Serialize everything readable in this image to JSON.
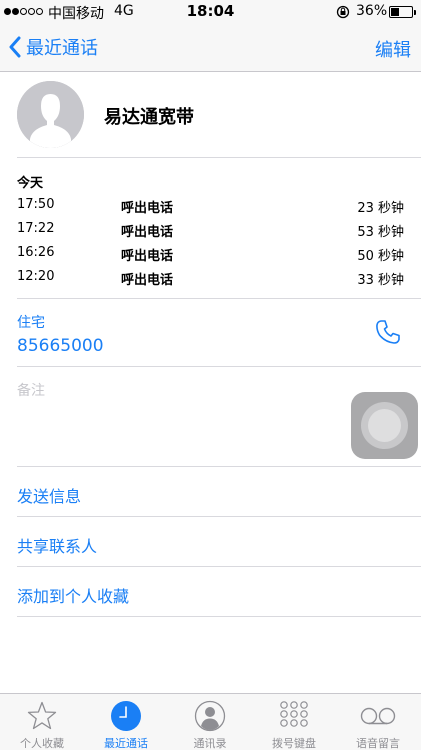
{
  "status_bar": {
    "carrier": "中国移动",
    "network": "4G",
    "time": "18:04",
    "battery": "36%",
    "battery_level": 0.36
  },
  "nav": {
    "back_label": "最近通话",
    "edit_label": "编辑"
  },
  "contact": {
    "name": "易达通宽带"
  },
  "calls": {
    "title": "今天",
    "items": [
      {
        "time": "17:50",
        "type": "呼出电话",
        "duration": "23 秒钟"
      },
      {
        "time": "17:22",
        "type": "呼出电话",
        "duration": "53 秒钟"
      },
      {
        "time": "16:26",
        "type": "呼出电话",
        "duration": "50 秒钟"
      },
      {
        "time": "12:20",
        "type": "呼出电话",
        "duration": "33 秒钟"
      }
    ]
  },
  "phone": {
    "label": "住宅",
    "number": "85665000"
  },
  "notes": {
    "label": "备注"
  },
  "actions": {
    "send_message": "发送信息",
    "share_contact": "共享联系人",
    "add_favorite": "添加到个人收藏"
  },
  "tabs": [
    {
      "label": "个人收藏",
      "icon": "star-icon"
    },
    {
      "label": "最近通话",
      "icon": "clock-icon"
    },
    {
      "label": "通讯录",
      "icon": "contacts-icon"
    },
    {
      "label": "拨号键盘",
      "icon": "keypad-icon"
    },
    {
      "label": "语音留言",
      "icon": "voicemail-icon"
    }
  ],
  "colors": {
    "accent": "#1a7ff5",
    "separator": "#d9d9de",
    "bar_background": "#f7f7f7"
  }
}
